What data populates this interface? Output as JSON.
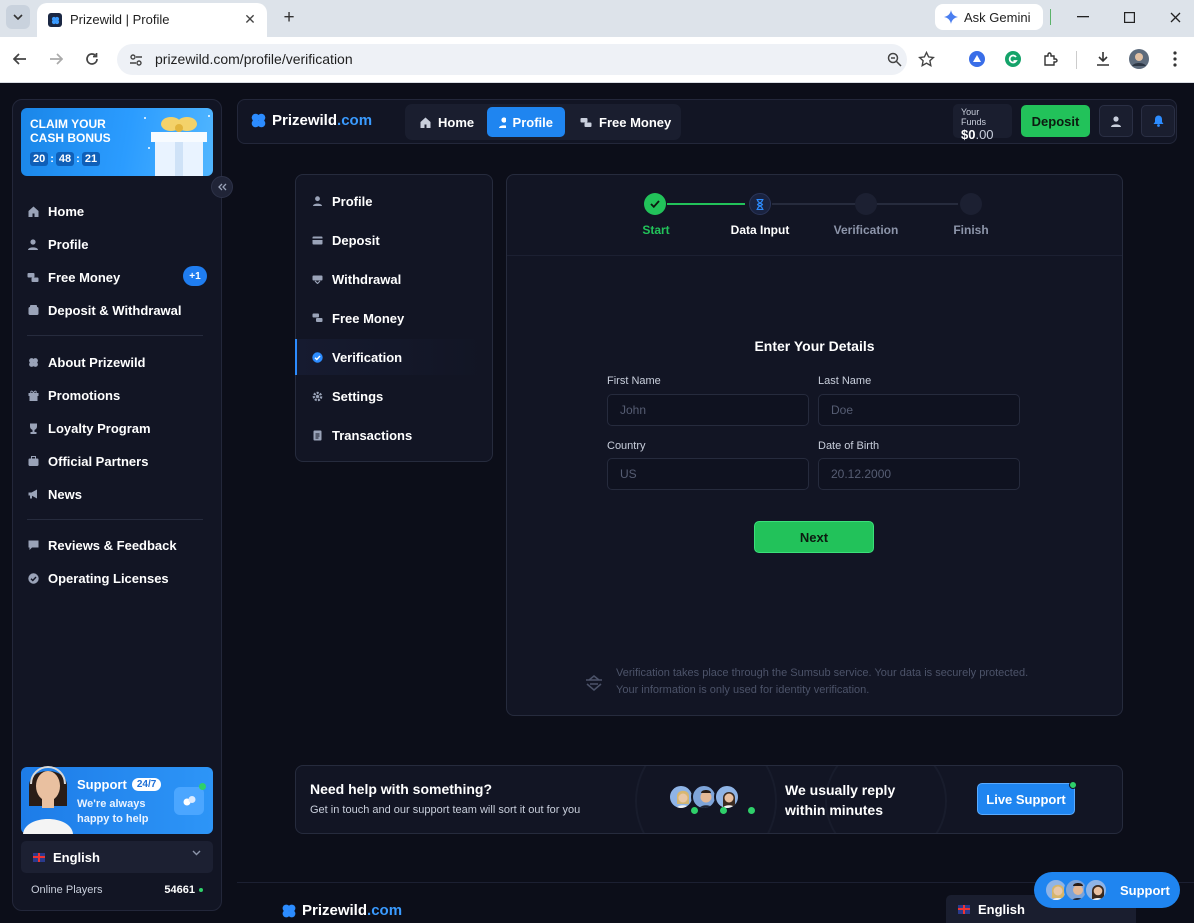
{
  "browser": {
    "tab_title": "Prizewild | Profile",
    "url": "prizewild.com/profile/verification",
    "ask_gemini": "Ask Gemini"
  },
  "sidebar": {
    "promo": {
      "title": "CLAIM YOUR CASH BONUS",
      "hours": "20",
      "minutes": "48",
      "seconds": "21"
    },
    "items": [
      {
        "label": "Home",
        "icon": "home-icon"
      },
      {
        "label": "Profile",
        "icon": "user-icon"
      },
      {
        "label": "Free Money",
        "icon": "money-icon",
        "badge": "+1"
      },
      {
        "label": "Deposit & Withdrawal",
        "icon": "wallet-icon"
      },
      {
        "label": "About Prizewild",
        "icon": "clover-icon"
      },
      {
        "label": "Promotions",
        "icon": "gift-icon"
      },
      {
        "label": "Loyalty Program",
        "icon": "trophy-icon"
      },
      {
        "label": "Official Partners",
        "icon": "briefcase-icon"
      },
      {
        "label": "News",
        "icon": "megaphone-icon"
      },
      {
        "label": "Reviews & Feedback",
        "icon": "chat-icon"
      },
      {
        "label": "Operating Licenses",
        "icon": "badge-check-icon"
      }
    ],
    "support": {
      "title": "Support",
      "hours": "24/7",
      "line1": "We're always",
      "line2": "happy to help"
    },
    "language": "English",
    "online_label": "Online Players",
    "online_count": "54661"
  },
  "header": {
    "logo_main": "Prizewild",
    "logo_suffix": ".com",
    "nav": [
      {
        "label": "Home",
        "active": false
      },
      {
        "label": "Profile",
        "active": true
      },
      {
        "label": "Free Money",
        "active": false
      }
    ],
    "funds_label": "Your Funds",
    "funds_whole": "$0",
    "funds_cents": ".00",
    "deposit_label": "Deposit"
  },
  "profile_menu": {
    "items": [
      {
        "label": "Profile"
      },
      {
        "label": "Deposit"
      },
      {
        "label": "Withdrawal"
      },
      {
        "label": "Free Money"
      },
      {
        "label": "Verification",
        "active": true
      },
      {
        "label": "Settings"
      },
      {
        "label": "Transactions"
      }
    ]
  },
  "stepper": {
    "steps": [
      {
        "label": "Start",
        "state": "done"
      },
      {
        "label": "Data Input",
        "state": "current"
      },
      {
        "label": "Verification",
        "state": "pending"
      },
      {
        "label": "Finish",
        "state": "pending"
      }
    ],
    "done_color": "#22c25a",
    "current_color": "#1f85f0"
  },
  "form": {
    "title": "Enter Your Details",
    "first_name": {
      "label": "First Name",
      "placeholder": "John"
    },
    "last_name": {
      "label": "Last Name",
      "placeholder": "Doe"
    },
    "country": {
      "label": "Country",
      "placeholder": "US"
    },
    "dob": {
      "label": "Date of Birth",
      "placeholder": "20.12.2000"
    },
    "next_label": "Next",
    "note_line1": "Verification takes place through the Sumsub service. Your data is securely protected.",
    "note_line2": "Your information is only used for identity verification."
  },
  "help": {
    "title": "Need help with something?",
    "subtitle": "Get in touch and our support team will sort it out for you",
    "reply_line1": "We usually reply",
    "reply_line2": "within minutes",
    "button": "Live Support"
  },
  "footer": {
    "logo_main": "Prizewild",
    "logo_suffix": ".com",
    "language": "English",
    "support_label": "Support"
  }
}
